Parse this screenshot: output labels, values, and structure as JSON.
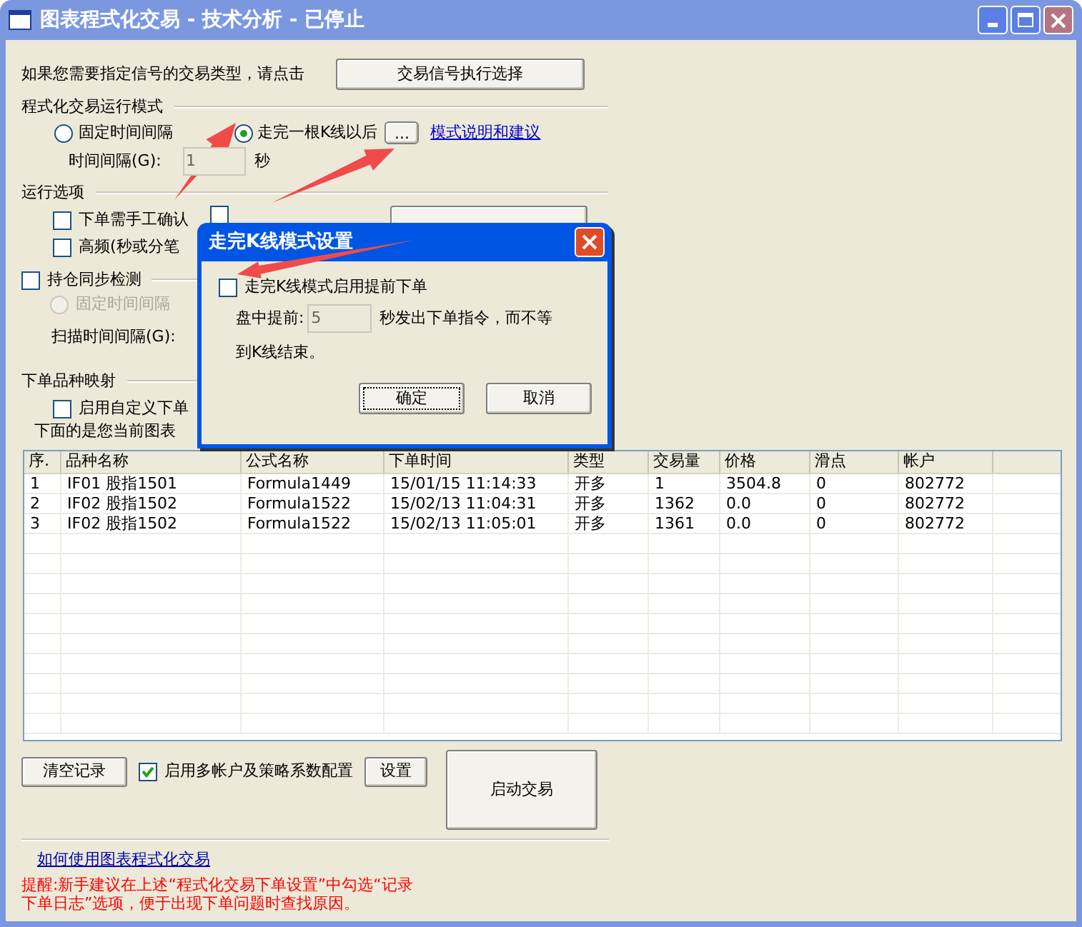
{
  "window": {
    "title": "图表程式化交易 - 技术分析 - 已停止"
  },
  "signal_prompt": {
    "text": "如果您需要指定信号的交易类型，请点击",
    "button": "交易信号执行选择"
  },
  "run_mode": {
    "heading": "程式化交易运行模式",
    "options": [
      {
        "label": "固定时间间隔",
        "selected": false
      },
      {
        "label": "走完一根K线以后",
        "selected": true
      }
    ],
    "more_button": "...",
    "help_link": "模式说明和建议",
    "interval_label": "时间间隔(G):",
    "interval_value": "1",
    "interval_disabled": true,
    "interval_unit": "秒"
  },
  "run_options": {
    "heading": "运行选项",
    "checkboxes": [
      {
        "label": "下单需手工确认",
        "checked": false
      },
      {
        "checked": false
      },
      {
        "label": "高频(秒或分笔",
        "checked": false
      }
    ]
  },
  "position_sync": {
    "label": "持仓同步检测",
    "checked": false,
    "option": {
      "label": "固定时间间隔",
      "selected": false,
      "disabled": true
    },
    "scan_label": "扫描时间间隔(G):"
  },
  "symbol_mapping": {
    "heading": "下单品种映射",
    "checkbox": {
      "label": "启用自定义下单",
      "checked": false
    },
    "note": "下面的是您当前图表"
  },
  "table": {
    "columns": [
      "序.",
      "品种名称",
      "公式名称",
      "下单时间",
      "类型",
      "交易量",
      "价格",
      "滑点",
      "帐户"
    ],
    "rows": [
      [
        "1",
        "IF01 股指1501",
        "Formula1449",
        "15/01/15 11:14:33",
        "开多",
        "1",
        "3504.8",
        "0",
        "802772"
      ],
      [
        "2",
        "IF02 股指1502",
        "Formula1522",
        "15/02/13 11:04:31",
        "开多",
        "1362",
        "0.0",
        "0",
        "802772"
      ],
      [
        "3",
        "IF02 股指1502",
        "Formula1522",
        "15/02/13 11:05:01",
        "开多",
        "1361",
        "0.0",
        "0",
        "802772"
      ]
    ]
  },
  "bottom": {
    "clear_button": "清空记录",
    "multi_account": {
      "label": "启用多帐户及策略系数配置",
      "checked": true
    },
    "setup_button": "设置",
    "start_button": "启动交易"
  },
  "help_link": "如何使用图表程式化交易",
  "tip_lines": [
    "提醒:新手建议在上述“程式化交易下单设置”中勾选“记录",
    "下单日志”选项，便于出现下单问题时查找原因。"
  ],
  "dialog": {
    "title": "走完K线模式设置",
    "checkbox": {
      "label": "走完K线模式启用提前下单",
      "checked": false
    },
    "advance_label": "盘中提前:",
    "advance_value": "5",
    "advance_disabled": true,
    "advance_text_lines": [
      "秒发出下单指令，而不等",
      "到K线结束。"
    ],
    "ok_button": "确定",
    "cancel_button": "取消"
  }
}
